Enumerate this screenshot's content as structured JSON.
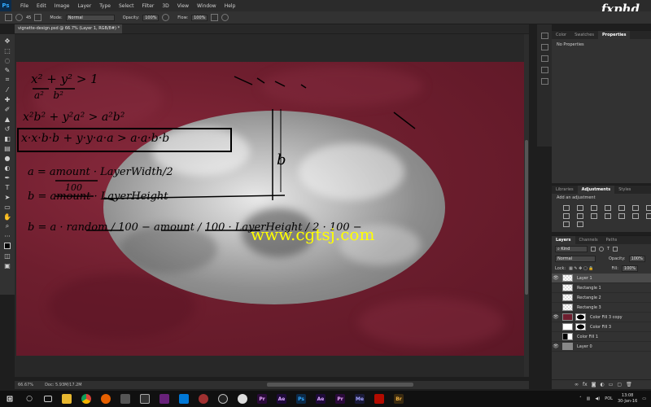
{
  "app": {
    "logo": "Ps",
    "brand": "fxphd"
  },
  "menu": [
    "File",
    "Edit",
    "Image",
    "Layer",
    "Type",
    "Select",
    "Filter",
    "3D",
    "View",
    "Window",
    "Help"
  ],
  "options": {
    "brush_size": "45",
    "mode_label": "Mode:",
    "mode_value": "Normal",
    "opacity_label": "Opacity:",
    "opacity_value": "100%",
    "flow_label": "Flow:",
    "flow_value": "100%"
  },
  "document": {
    "tab_title": "vignette-design.psd @ 66.7% (Layer 1, RGB/8#) *"
  },
  "watermark": "www.cgtsj.com",
  "handwriting": {
    "line1": "x² + y² > 1",
    "line1_den": "a²   b²",
    "line2": "x²b² + y²a² > a²b²",
    "line3": "x·x·b·b + y·y·a·a > a·a·b·b",
    "line4": "a = amount · LayerWidth/2",
    "line4_den": "100",
    "line5": "b = amount · LayerHeight",
    "line6": "b = a · random / 100 − amount / 100 · LayerHeight / 2 · 100 −",
    "label_b": "b"
  },
  "status": {
    "zoom": "66.67%",
    "doc": "Doc: 5.93M/17.2M"
  },
  "panels": {
    "top_tabs": [
      "Color",
      "Swatches",
      "Properties"
    ],
    "top_active": "Properties",
    "top_content": "No Properties",
    "mid_tabs": [
      "Libraries",
      "Adjustments",
      "Styles"
    ],
    "mid_active": "Adjustments",
    "mid_content": "Add an adjustment",
    "layer_tabs": [
      "Layers",
      "Channels",
      "Paths"
    ],
    "layer_active": "Layers",
    "kind": "Kind",
    "blend": "Normal",
    "opacity_label": "Opacity:",
    "opacity": "100%",
    "lock_label": "Lock:",
    "fill_label": "Fill:",
    "fill": "100%"
  },
  "layers": [
    {
      "name": "Layer 1",
      "visible": true,
      "selected": true
    },
    {
      "name": "Rectangle 1",
      "visible": false,
      "selected": false
    },
    {
      "name": "Rectangle 2",
      "visible": false,
      "selected": false
    },
    {
      "name": "Rectangle 3",
      "visible": false,
      "selected": false
    },
    {
      "name": "Color Fill 3 copy",
      "visible": true,
      "selected": false
    },
    {
      "name": "Color Fill 3",
      "visible": false,
      "selected": false
    },
    {
      "name": "Color Fill 1",
      "visible": false,
      "selected": false
    },
    {
      "name": "Layer 0",
      "visible": true,
      "selected": false
    }
  ],
  "taskbar": {
    "lang": "POL",
    "time": "13:08",
    "date": "30-Jan-16"
  },
  "colors": {
    "canvas_red": "#6e1e2e",
    "watermark": "#ffff00",
    "accent_ps": "#31a8ff"
  }
}
